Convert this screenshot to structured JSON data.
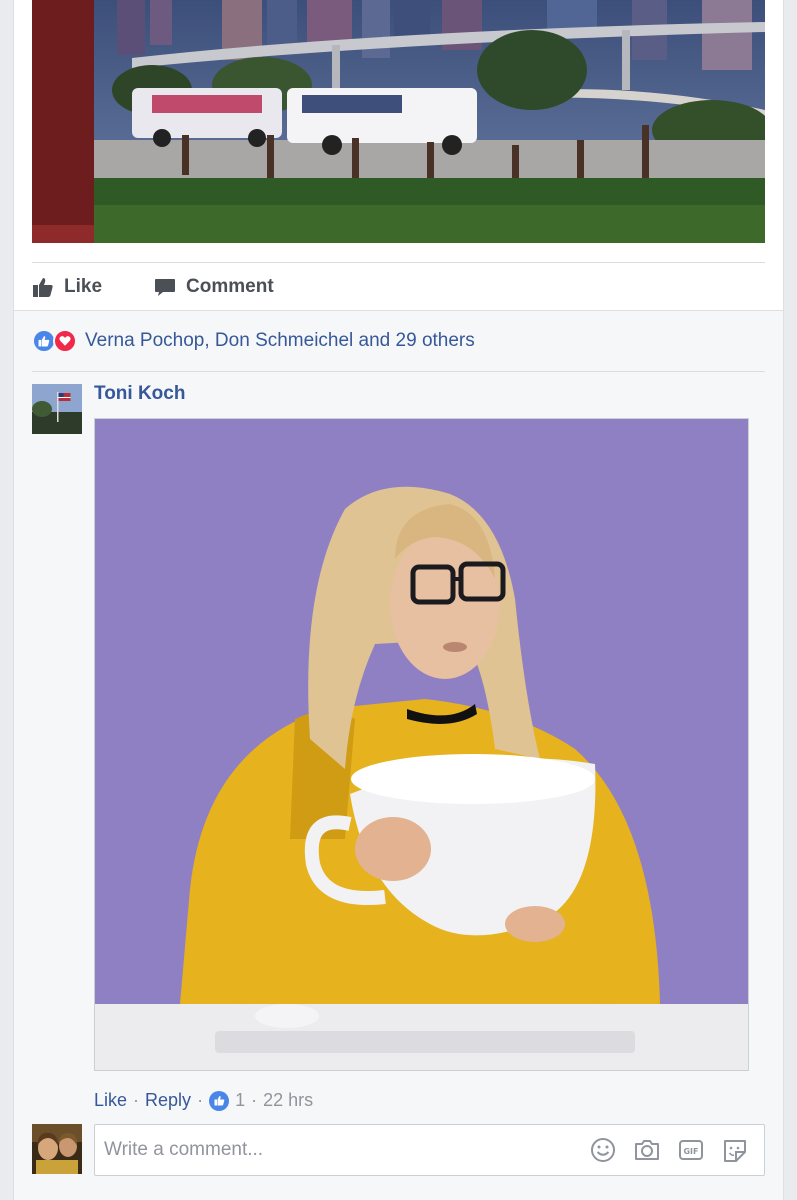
{
  "post": {
    "actions": {
      "like_label": "Like",
      "comment_label": "Comment"
    }
  },
  "reactions": {
    "summary": "Verna Pochop, Don Schmeichel and 29 others",
    "types": [
      "like",
      "love"
    ]
  },
  "comment": {
    "author": "Toni Koch",
    "actions": {
      "like": "Like",
      "reply": "Reply",
      "sep": "·",
      "like_count": "1",
      "time": "22 hrs"
    }
  },
  "composer": {
    "placeholder": "Write a comment...",
    "icons": [
      "emoji-icon",
      "camera-icon",
      "gif-icon",
      "sticker-icon"
    ]
  },
  "colors": {
    "link": "#365899",
    "like_blue": "#4a86e8",
    "love_red": "#f0284a",
    "gif_background": "#8f80c4"
  }
}
